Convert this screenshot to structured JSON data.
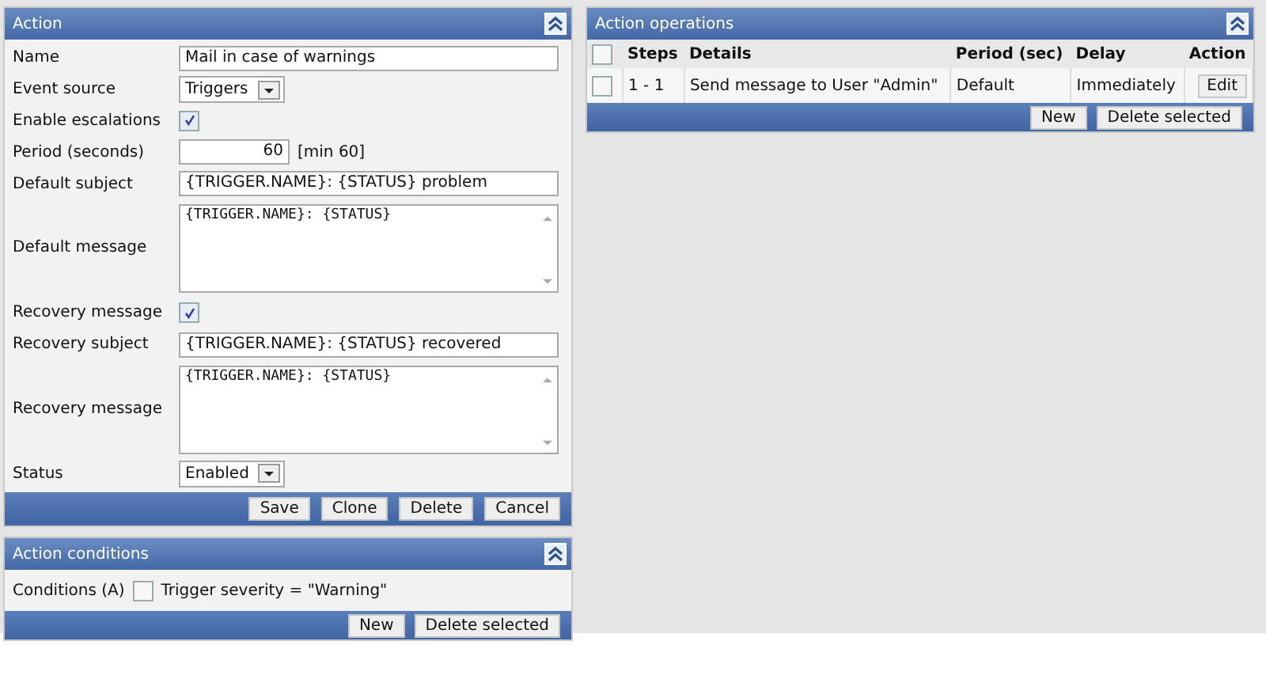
{
  "action": {
    "title": "Action",
    "fields": [
      {
        "kind": "text",
        "label": "Name",
        "value": "Mail in case of warnings"
      },
      {
        "kind": "select",
        "label": "Event source",
        "value": "Triggers"
      },
      {
        "kind": "checkbox",
        "label": "Enable escalations",
        "checked": true
      },
      {
        "kind": "number",
        "label": "Period (seconds)",
        "value": "60",
        "hint": "[min 60]"
      },
      {
        "kind": "text",
        "label": "Default subject",
        "value": "{TRIGGER.NAME}: {STATUS} problem"
      },
      {
        "kind": "textarea",
        "label": "Default message",
        "value": "{TRIGGER.NAME}: {STATUS}"
      },
      {
        "kind": "checkbox",
        "label": "Recovery message",
        "checked": true
      },
      {
        "kind": "text",
        "label": "Recovery subject",
        "value": "{TRIGGER.NAME}: {STATUS} recovered"
      },
      {
        "kind": "textarea",
        "label": "Recovery message",
        "value": "{TRIGGER.NAME}: {STATUS}"
      },
      {
        "kind": "select",
        "label": "Status",
        "value": "Enabled"
      }
    ],
    "buttons": [
      "Save",
      "Clone",
      "Delete",
      "Cancel"
    ]
  },
  "conditions": {
    "title": "Action conditions",
    "label": "Conditions (A)",
    "items": [
      {
        "checked": false,
        "text": "Trigger severity = \"Warning\""
      }
    ],
    "buttons": [
      "New",
      "Delete selected"
    ]
  },
  "operations": {
    "title": "Action operations",
    "select_all": false,
    "columns": [
      "Steps",
      "Details",
      "Period (sec)",
      "Delay",
      "Action"
    ],
    "rows": [
      {
        "checked": false,
        "steps": "1 - 1",
        "details": "Send message to User \"Admin\"",
        "period": "Default",
        "delay": "Immediately",
        "action": "Edit"
      }
    ],
    "buttons": [
      "New",
      "Delete selected"
    ]
  }
}
